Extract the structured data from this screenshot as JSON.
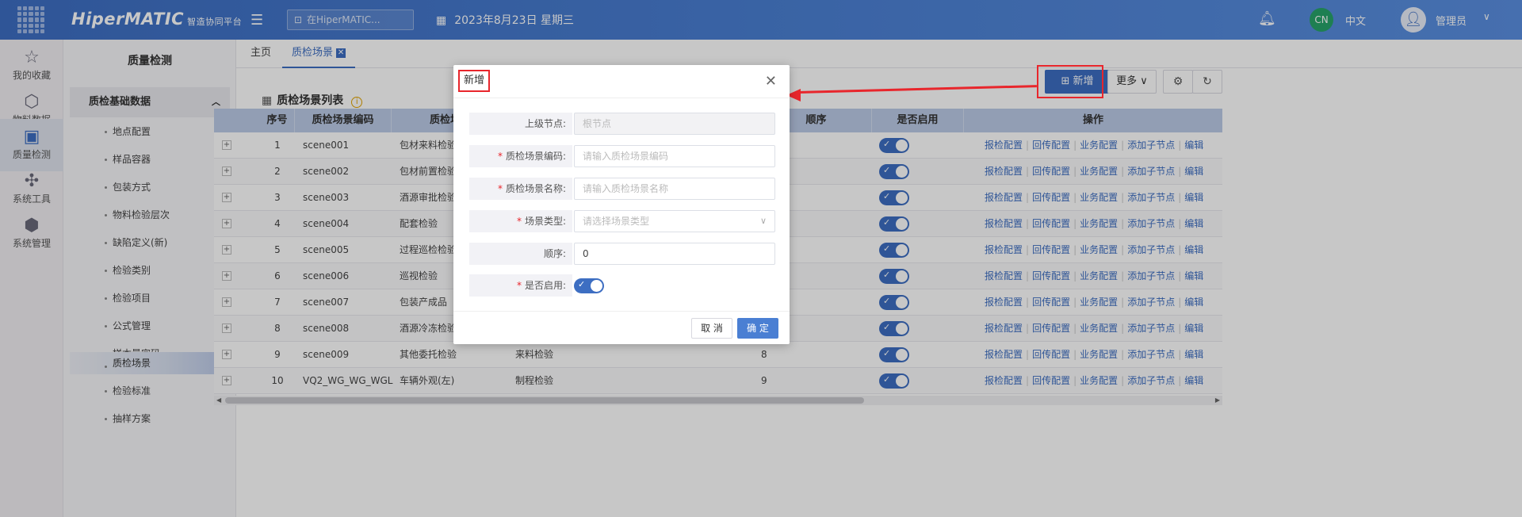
{
  "topbar": {
    "logo": "HiperMATIC",
    "logo_sub": "智造协同平台",
    "search_placeholder": "在HiperMATIC...",
    "date": "2023年8月23日 星期三",
    "lang_avatar": "CN",
    "lang_label": "中文",
    "user_label": "管理员"
  },
  "leftnav": [
    {
      "icon": "star-icon",
      "label": "我的收藏"
    },
    {
      "icon": "cube-icon",
      "label": "物料数据"
    },
    {
      "icon": "clipboard-check-icon",
      "label": "质量检测"
    },
    {
      "icon": "network-icon",
      "label": "系统工具"
    },
    {
      "icon": "settings-cube-icon",
      "label": "系统管理"
    }
  ],
  "subnav": {
    "title": "质量检测",
    "group": "质检基础数据",
    "items": [
      "地点配置",
      "样品容器",
      "包装方式",
      "物料检验层次",
      "缺陷定义(新)",
      "检验类别",
      "检验项目",
      "公式管理",
      "样本量字码",
      "质检场景",
      "检验标准",
      "抽样方案"
    ]
  },
  "tabs": {
    "home": "主页",
    "active": "质检场景"
  },
  "panel": {
    "title": "质检场景列表",
    "add_label": "新增",
    "more_label": "更多"
  },
  "table": {
    "headers": {
      "index": "序号",
      "code": "质检场景编码",
      "name": "质检场",
      "order": "顺序",
      "enabled": "是否启用",
      "ops": "操作"
    },
    "ops": [
      "报检配置",
      "回传配置",
      "业务配置",
      "添加子节点",
      "编辑"
    ],
    "rows": [
      {
        "index": "1",
        "code": "scene001",
        "name": "包材来料检验",
        "type": "",
        "order": ""
      },
      {
        "index": "2",
        "code": "scene002",
        "name": "包材前置检验",
        "type": "",
        "order": ""
      },
      {
        "index": "3",
        "code": "scene003",
        "name": "酒源审批检验",
        "type": "",
        "order": ""
      },
      {
        "index": "4",
        "code": "scene004",
        "name": "配套检验",
        "type": "",
        "order": ""
      },
      {
        "index": "5",
        "code": "scene005",
        "name": "过程巡检检验",
        "type": "",
        "order": ""
      },
      {
        "index": "6",
        "code": "scene006",
        "name": "巡视检验",
        "type": "",
        "order": ""
      },
      {
        "index": "7",
        "code": "scene007",
        "name": "包装产成品",
        "type": "",
        "order": ""
      },
      {
        "index": "8",
        "code": "scene008",
        "name": "酒源冷冻检验",
        "type": "",
        "order": ""
      },
      {
        "index": "9",
        "code": "scene009",
        "name": "其他委托检验",
        "type": "来料检验",
        "order": "8"
      },
      {
        "index": "10",
        "code": "VQ2_WG_WG_WGL",
        "name": "车辆外观(左)",
        "type": "制程检验",
        "order": "9"
      }
    ]
  },
  "modal": {
    "title": "新增",
    "fields": [
      {
        "label": "上级节点:",
        "required": false,
        "placeholder": "根节点",
        "kind": "disabled"
      },
      {
        "label": "质检场景编码:",
        "required": true,
        "placeholder": "请输入质检场景编码",
        "kind": "input"
      },
      {
        "label": "质检场景名称:",
        "required": true,
        "placeholder": "请输入质检场景名称",
        "kind": "input"
      },
      {
        "label": "场景类型:",
        "required": true,
        "placeholder": "请选择场景类型",
        "kind": "select"
      },
      {
        "label": "顺序:",
        "required": false,
        "value": "0",
        "kind": "value"
      },
      {
        "label": "是否启用:",
        "required": true,
        "kind": "toggle"
      }
    ],
    "cancel_label": "取 消",
    "ok_label": "确 定"
  },
  "colors": {
    "primary": "#3d6ec2",
    "annotation": "#e8262c"
  }
}
